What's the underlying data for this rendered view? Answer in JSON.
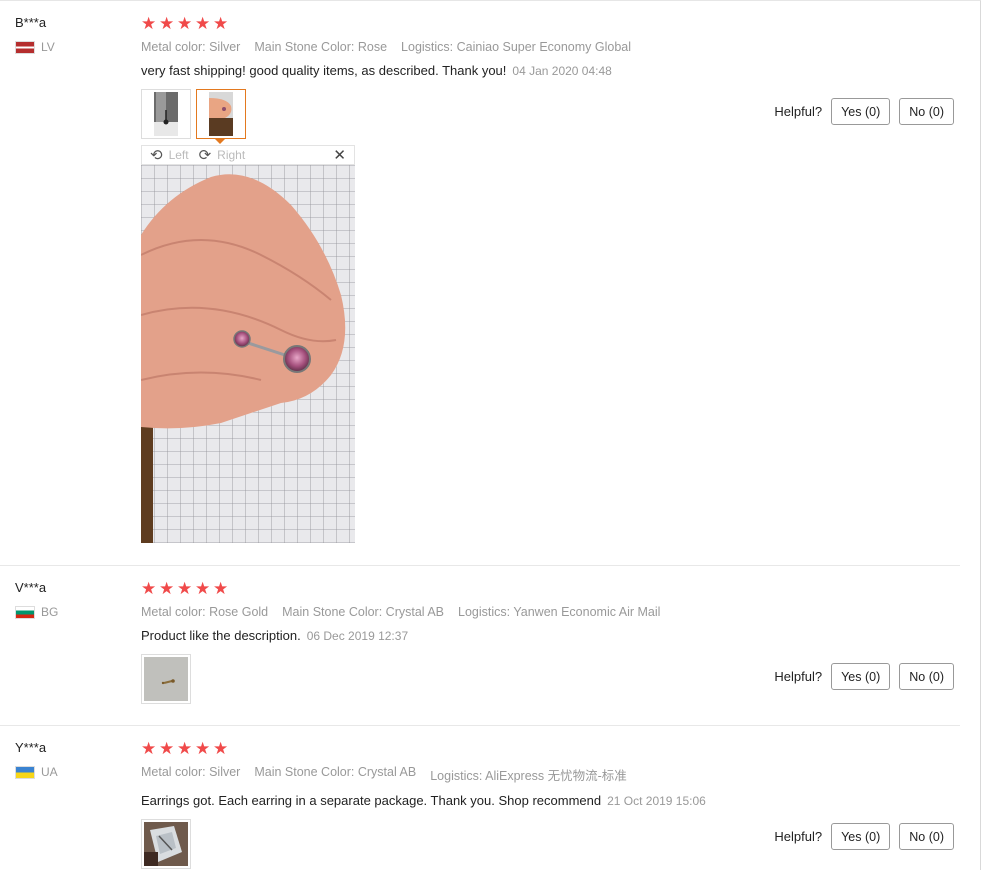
{
  "helpful_label": "Helpful?",
  "viewer": {
    "left_label": "Left",
    "right_label": "Right"
  },
  "colors": {
    "star": "#f04a4a",
    "active_thumb_border": "#e3791f",
    "meta_text": "#999999"
  },
  "reviews": [
    {
      "user": "B***a",
      "country_code": "LV",
      "rating": 5,
      "attrs": [
        "Metal color: Silver",
        "Main Stone Color: Rose",
        "Logistics: Cainiao Super Economy Global"
      ],
      "text": "very fast shipping! good quality items, as described. Thank you!",
      "date": "04 Jan 2020 04:48",
      "yes_label": "Yes (0)",
      "no_label": "No (0)",
      "thumb_count": 2,
      "viewer_open": true
    },
    {
      "user": "V***a",
      "country_code": "BG",
      "rating": 5,
      "attrs": [
        "Metal color: Rose Gold",
        "Main Stone Color: Crystal AB",
        "Logistics: Yanwen Economic Air Mail"
      ],
      "text": "Product like the description.",
      "date": "06 Dec 2019 12:37",
      "yes_label": "Yes (0)",
      "no_label": "No (0)",
      "thumb_count": 1
    },
    {
      "user": "Y***a",
      "country_code": "UA",
      "rating": 5,
      "attrs": [
        "Metal color: Silver",
        "Main Stone Color: Crystal AB",
        "Logistics: AliExpress 无忧物流-标准"
      ],
      "text": "Earrings got. Each earring in a separate package. Thank you. Shop recommend",
      "date": "21 Oct 2019 15:06",
      "yes_label": "Yes (0)",
      "no_label": "No (0)",
      "thumb_count": 1
    }
  ]
}
